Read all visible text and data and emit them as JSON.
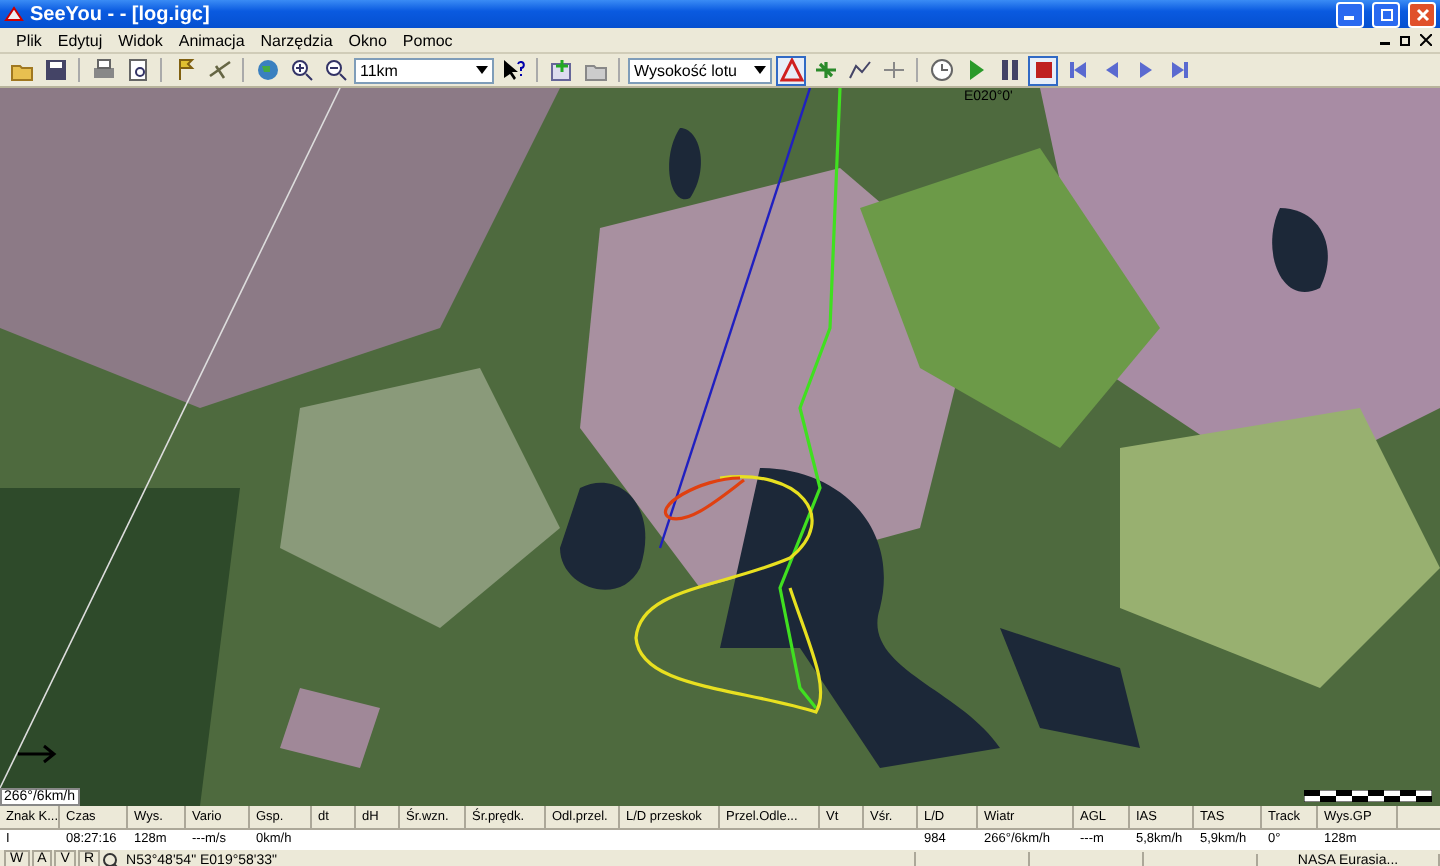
{
  "window": {
    "title": "SeeYou - - [log.igc]"
  },
  "menu": [
    "Plik",
    "Edytuj",
    "Widok",
    "Animacja",
    "Narzędzia",
    "Okno",
    "Pomoc"
  ],
  "toolbar": {
    "zoom_combo": "11km",
    "altitude_combo": "Wysokość lotu",
    "track_mode_pressed": true,
    "stop_pressed": true
  },
  "map": {
    "grid_label": "E020°0'",
    "wind_label": "266°/6km/h"
  },
  "table": {
    "columns": [
      {
        "label": "Znak K...",
        "value": "I"
      },
      {
        "label": "Czas",
        "value": "08:27:16"
      },
      {
        "label": "Wys.",
        "value": "128m"
      },
      {
        "label": "Vario",
        "value": "---m/s"
      },
      {
        "label": "Gsp.",
        "value": "0km/h"
      },
      {
        "label": "dt"
      },
      {
        "label": "dH"
      },
      {
        "label": "Śr.wzn."
      },
      {
        "label": "Śr.prędk."
      },
      {
        "label": "Odl.przel."
      },
      {
        "label": "L/D przeskok"
      },
      {
        "label": "Przel.Odle..."
      },
      {
        "label": "Vt"
      },
      {
        "label": "Vśr."
      },
      {
        "label": "L/D",
        "value": "984"
      },
      {
        "label": "Wiatr",
        "value": "266°/6km/h"
      },
      {
        "label": "AGL",
        "value": "---m"
      },
      {
        "label": "IAS",
        "value": "5,8km/h"
      },
      {
        "label": "TAS",
        "value": "5,9km/h"
      },
      {
        "label": "Track",
        "value": "0°"
      },
      {
        "label": "Wys.GP",
        "value": "128m"
      }
    ]
  },
  "status_bar": {
    "mode_buttons": [
      "W",
      "A",
      "V",
      "R"
    ],
    "coordinates": "N53°48'54\" E019°58'33\"",
    "map_source": "NASA Eurasia..."
  }
}
